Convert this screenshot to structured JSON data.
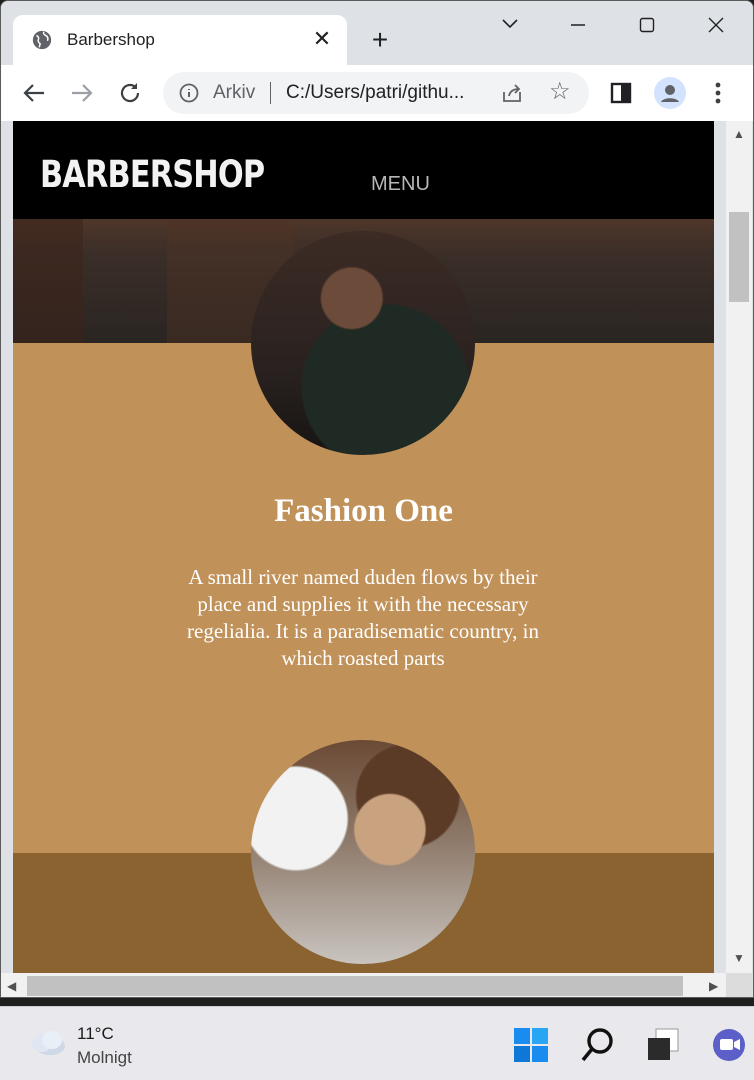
{
  "browser": {
    "tab_title": "Barbershop",
    "tab_close_glyph": "✕",
    "new_tab_glyph": "+",
    "window_controls": {
      "dropdown": "⌄",
      "minimize": "—",
      "maximize": "☐",
      "close": "✕"
    },
    "omnibox": {
      "site_chip": "Arkiv",
      "url": "C:/Users/patri/githu..."
    }
  },
  "page": {
    "logo": "BARBERSHOP",
    "menu_label": "MENU",
    "section1": {
      "title": "Fashion One",
      "text": "A small river named duden flows by their place and supplies it with the necessary regelialia. It is a paradisematic country, in which roasted parts"
    },
    "colors": {
      "section1_bg": "#c09159",
      "section2_bg": "#8b6331",
      "navbar_bg": "#000000"
    }
  },
  "taskbar": {
    "weather_temp": "11°C",
    "weather_condition": "Molnigt"
  },
  "icons": [
    "globe-icon",
    "close-icon",
    "plus-icon",
    "back-icon",
    "forward-icon",
    "reload-icon",
    "info-icon",
    "share-icon",
    "star-icon",
    "sidepanel-icon",
    "profile-icon",
    "kebab-menu-icon",
    "weather-icon",
    "windows-start-icon",
    "search-icon",
    "task-view-icon",
    "chat-icon"
  ]
}
